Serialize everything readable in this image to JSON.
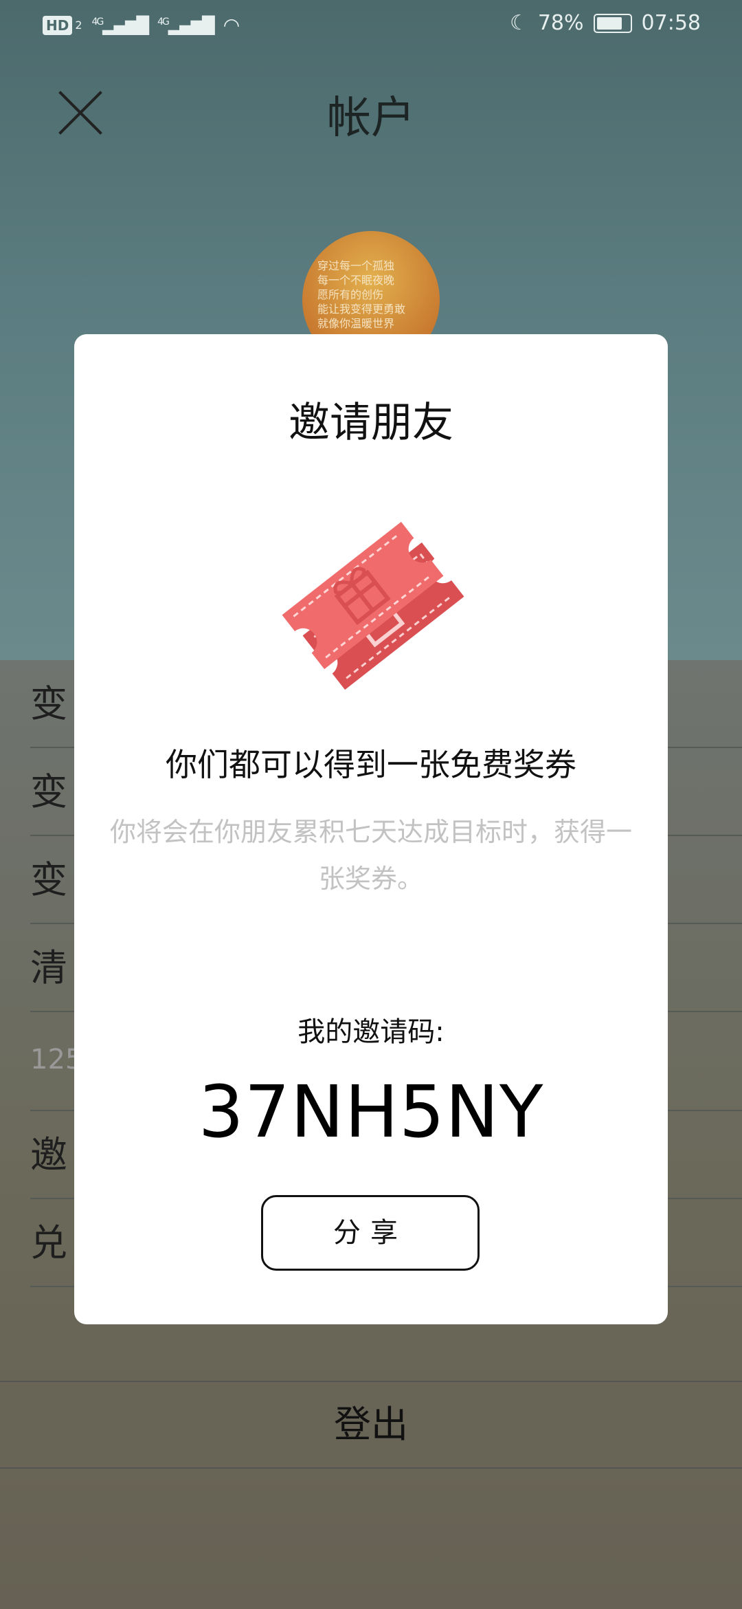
{
  "status_bar": {
    "hd": "HD",
    "sim_index": "2",
    "signal_1": "4G",
    "signal_2": "4G",
    "battery": "78%",
    "time": "07:58"
  },
  "header": {
    "title": "帐户",
    "close_icon": "close-icon"
  },
  "avatar": {
    "lines": [
      "穿过每一个孤独",
      "每一个不眠夜晚",
      "愿所有的创伤",
      "能让我变得更勇敢",
      "就像你温暖世界"
    ]
  },
  "background_list": {
    "items": [
      "变",
      "变",
      "变",
      "清",
      "125",
      "邀",
      "兑"
    ],
    "logout": "登出"
  },
  "modal": {
    "title": "邀请朋友",
    "ticket_icon": "gift-ticket-icon",
    "headline": "你们都可以得到一张免费奖券",
    "subtext": "你将会在你朋友累积七天达成目标时，获得一张奖券。",
    "code_label": "我的邀请码:",
    "code_value": "37NH5NY",
    "share_label": "分享"
  },
  "colors": {
    "ticket": "#f06c6c",
    "ticket_dark": "#d94f52",
    "muted_text": "#c2c2c2"
  }
}
